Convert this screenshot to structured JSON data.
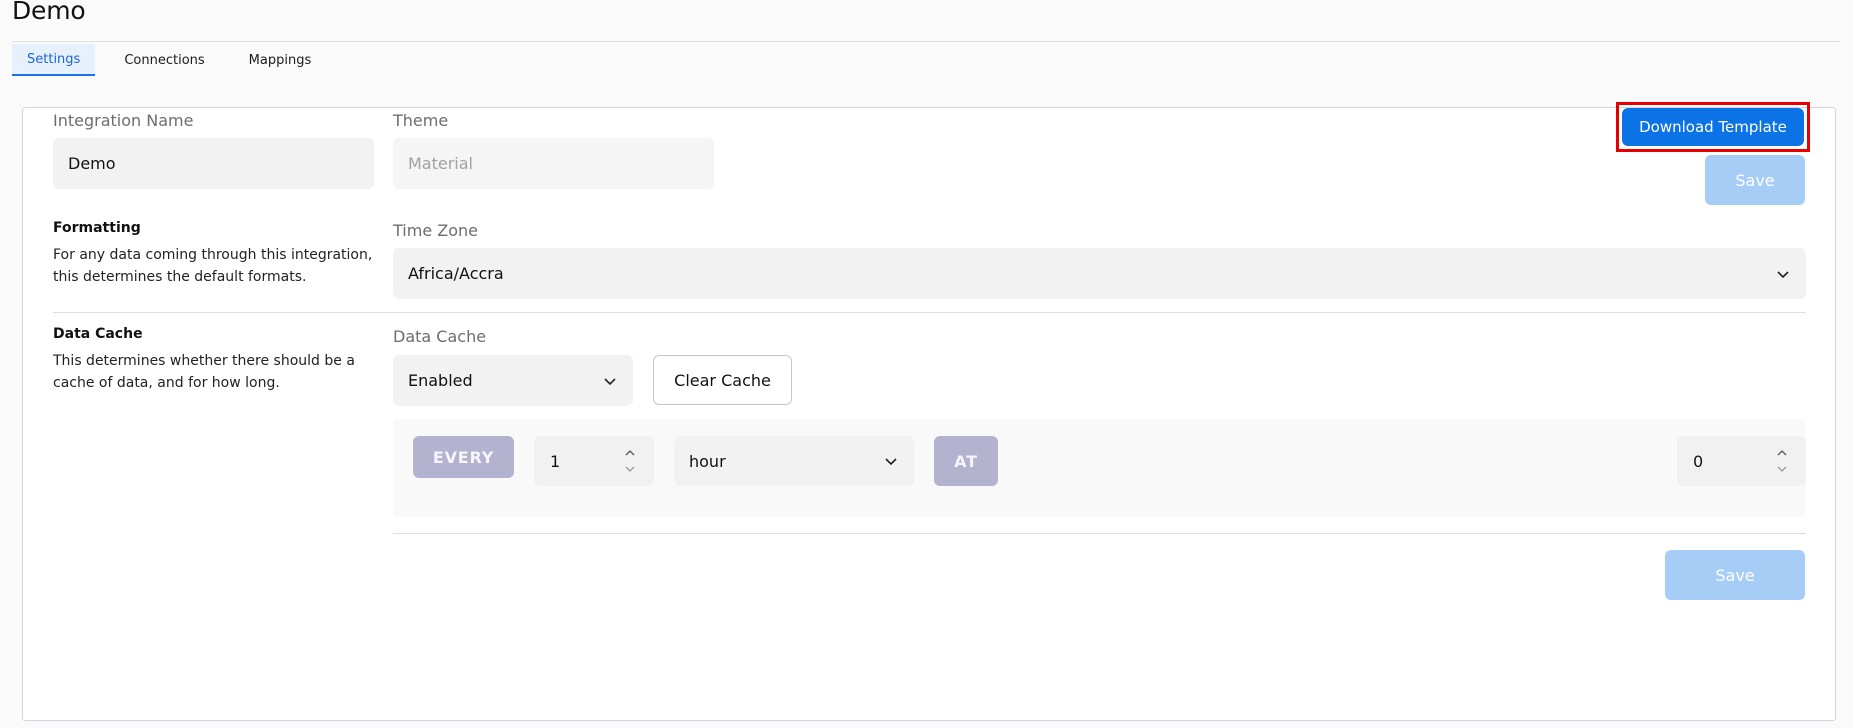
{
  "page": {
    "title": "Demo"
  },
  "tabs": [
    {
      "label": "Settings",
      "active": true
    },
    {
      "label": "Connections",
      "active": false
    },
    {
      "label": "Mappings",
      "active": false
    }
  ],
  "general": {
    "integration_name_label": "Integration Name",
    "integration_name_value": "Demo",
    "theme_label": "Theme",
    "theme_value": "Material",
    "download_template_label": "Download Template",
    "save_label": "Save"
  },
  "formatting": {
    "title": "Formatting",
    "description": "For any data coming through this integration, this determines the default formats.",
    "timezone_label": "Time Zone",
    "timezone_value": "Africa/Accra"
  },
  "data_cache": {
    "title": "Data Cache",
    "description": "This determines whether there should be a cache of data, and for how long.",
    "field_label": "Data Cache",
    "value": "Enabled",
    "clear_label": "Clear Cache",
    "schedule": {
      "every_label": "EVERY",
      "interval_value": "1",
      "unit_value": "hour",
      "at_label": "AT",
      "at_value": "0"
    },
    "save_label": "Save"
  },
  "colors": {
    "primary": "#0b73e5",
    "disabled": "#a6cdf5",
    "badge": "#b4b3cf",
    "highlight": "#e60000",
    "tab_active": "#1a73e8"
  },
  "icons": {
    "select_chevron": "chevron-down-icon",
    "stepper": "stepper-arrows-icon"
  }
}
